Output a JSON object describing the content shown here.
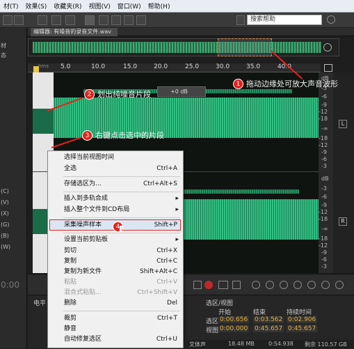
{
  "menu": [
    "材(T)",
    "效果(S)",
    "收藏夹(R)",
    "视图(V)",
    "窗口(W)",
    "帮助(H)"
  ],
  "search": {
    "placeholder": "搜索帮助"
  },
  "editor_tab": "编辑器: 有噪音的录音文件.wav",
  "ruler": {
    "ticks": [
      "hms",
      "5.0",
      "10.0",
      "15.0",
      "20.0",
      "25.0",
      "30.0",
      "35.0",
      "40.0"
    ]
  },
  "db_scale": [
    "dB",
    "-3",
    "-6",
    "-9",
    "-12",
    "-18",
    "-∞",
    "-18",
    "-12",
    "-9",
    "-6",
    "-3",
    "dB",
    "-3",
    "-6",
    "-9",
    "-12",
    "-18",
    "-∞",
    "-18",
    "-12",
    "-9",
    "-6",
    "-3"
  ],
  "channels": [
    "L",
    "R"
  ],
  "gain": "+0 dB",
  "callouts": [
    {
      "n": "1",
      "text": "拖动边缘处可放大声音波形"
    },
    {
      "n": "2",
      "text": "划出纯噪音片段"
    },
    {
      "n": "3",
      "text": "右键点击选中的片段"
    },
    {
      "n": "4",
      "text": ""
    }
  ],
  "context_menu": [
    {
      "label": "选择当前视图时间",
      "shortcut": ""
    },
    {
      "label": "全选",
      "shortcut": "Ctrl+A"
    },
    {
      "label": "存储选区为...",
      "shortcut": "Ctrl+Alt+S"
    },
    {
      "label": "插入到多轨合成",
      "shortcut": "",
      "submenu": true
    },
    {
      "label": "插入整个文件到CD布局",
      "shortcut": "",
      "submenu": true
    },
    {
      "label": "采集噪声样本",
      "shortcut": "Shift+P"
    },
    {
      "label": "设置当前剪贴板",
      "shortcut": "",
      "submenu": true
    },
    {
      "label": "剪切",
      "shortcut": "Ctrl+X"
    },
    {
      "label": "复制",
      "shortcut": "Ctrl+C"
    },
    {
      "label": "复制为新文件",
      "shortcut": "Shift+Alt+C"
    },
    {
      "label": "粘贴",
      "shortcut": "Ctrl+V",
      "disabled": true
    },
    {
      "label": "混合式粘贴...",
      "shortcut": "Ctrl+Shift+V",
      "disabled": true
    },
    {
      "label": "删除",
      "shortcut": "Del"
    },
    {
      "label": "裁剪",
      "shortcut": "Ctrl+T"
    },
    {
      "label": "静音",
      "shortcut": ""
    },
    {
      "label": "自动修复选区",
      "shortcut": "Ctrl+U"
    }
  ],
  "left_panel": [
    "材",
    "态",
    "(C)",
    "(V)",
    "(X)",
    "(G)",
    "(B)",
    "(W)",
    "0:00"
  ],
  "bottom": {
    "left_label": "电平",
    "selection_header": "选区/视图",
    "cols": [
      "开始",
      "结束",
      "持续时间"
    ],
    "rows": [
      {
        "name": "选区",
        "start": "0:00.656",
        "end": "0:03.562",
        "dur": "0:02.906"
      },
      {
        "name": "视图",
        "start": "0:00.000",
        "end": "0:45.657",
        "dur": "0:45.657"
      }
    ],
    "status": [
      "文体声",
      "18.48 MB",
      "0:54.938",
      "剩余 110.57 GB"
    ]
  }
}
